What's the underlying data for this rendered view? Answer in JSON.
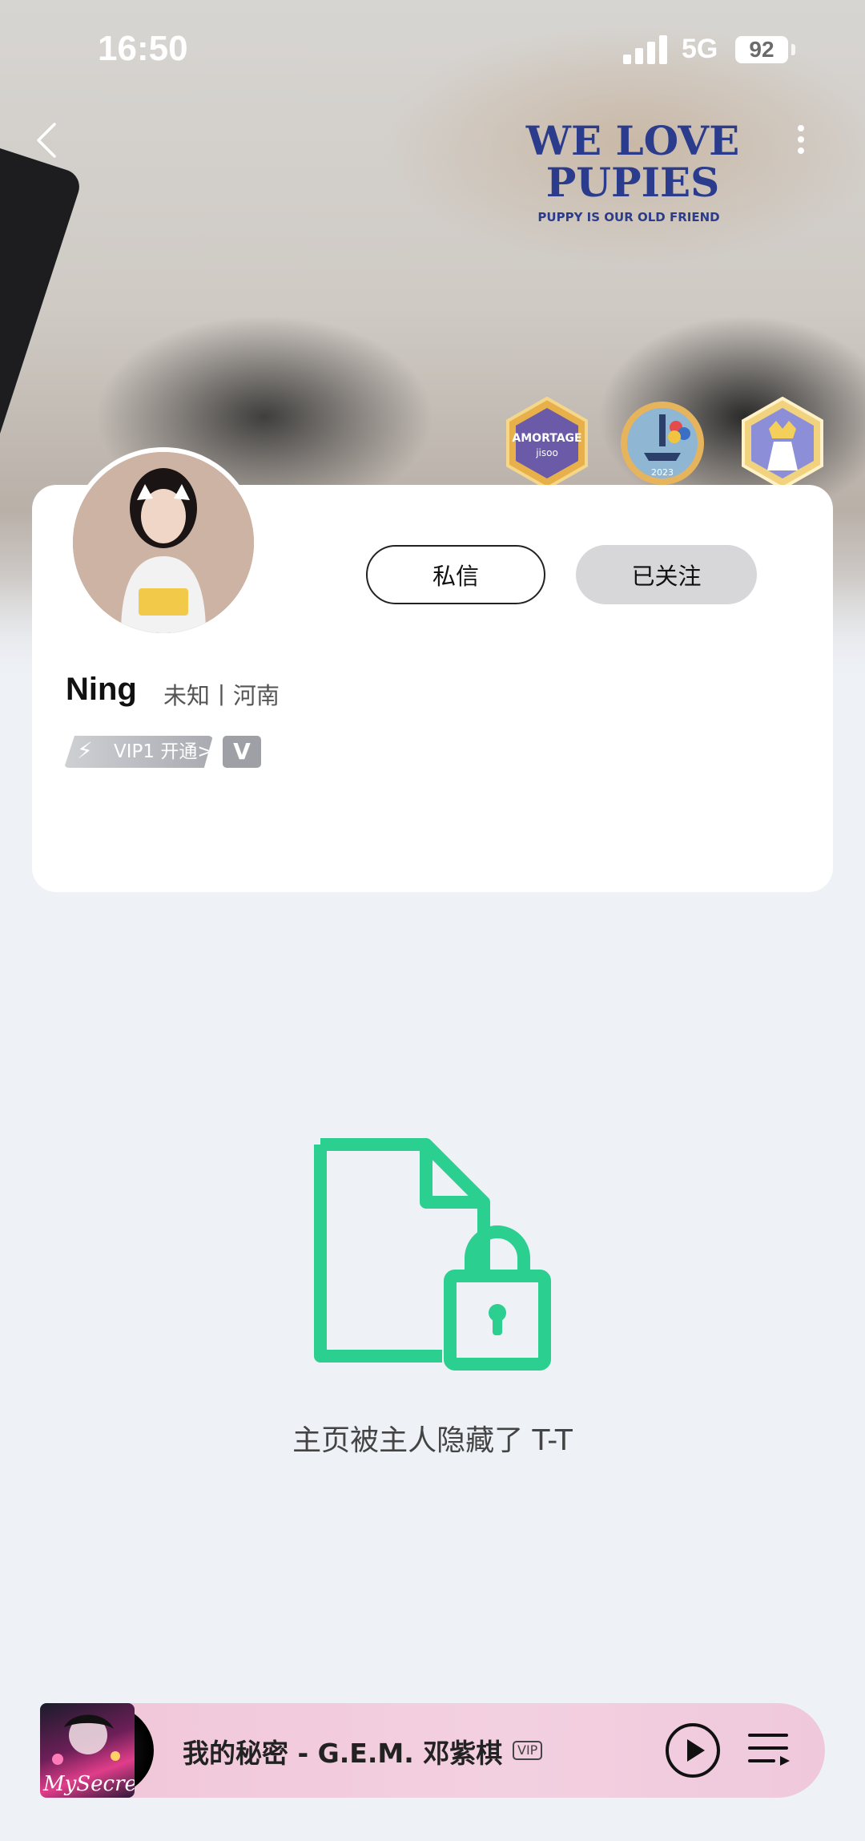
{
  "status_bar": {
    "time": "16:50",
    "network": "5G",
    "battery": "92"
  },
  "cover": {
    "cap_text_line1": "WE LOVE",
    "cap_text_line2": "PUPIES",
    "cap_subtext": "PUPPY IS OUR OLD FRIEND"
  },
  "nav": {
    "back_icon": "chevron-left-icon",
    "more_icon": "more-vertical-icon"
  },
  "badges": [
    {
      "name": "amortage-badge",
      "label": "AMORTAGE",
      "sublabel": "jisoo"
    },
    {
      "name": "seoul-tower-badge",
      "label": "2023"
    },
    {
      "name": "crown-card-badge"
    }
  ],
  "profile": {
    "name": "Ning",
    "meta": "未知丨河南",
    "vip_label": "VIP1 开通>",
    "v_badge": "V",
    "message_button": "私信",
    "follow_button": "已关注"
  },
  "empty_state": {
    "icon": "locked-document-icon",
    "text": "主页被主人隐藏了 T-T",
    "accent_color": "#2bcf8f"
  },
  "player": {
    "song": "我的秘密 - G.E.M. 邓紫棋",
    "vip_tag": "VIP",
    "album_text": "MySecret",
    "play_icon": "play-icon",
    "playlist_icon": "playlist-icon"
  }
}
